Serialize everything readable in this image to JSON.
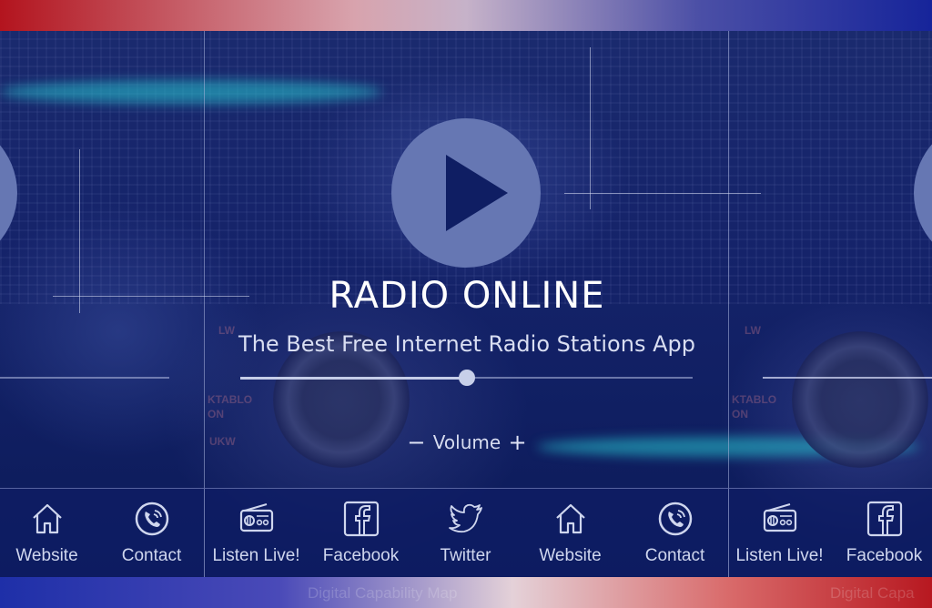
{
  "header": {
    "title": "RADIO ONLINE",
    "subtitle": "The Best Free Internet Radio Stations App"
  },
  "player": {
    "play_icon": "play-icon",
    "volume_label": "Volume",
    "volume_minus": "−",
    "volume_plus": "+",
    "volume_level": 0.5
  },
  "background": {
    "dial_labels": [
      "LW",
      "KTABLO",
      "ON",
      "UKW"
    ]
  },
  "nav": {
    "items": [
      {
        "label": "Website",
        "icon": "home-icon"
      },
      {
        "label": "Contact",
        "icon": "phone-icon"
      },
      {
        "label": "Listen Live!",
        "icon": "radio-icon"
      },
      {
        "label": "Facebook",
        "icon": "facebook-icon"
      },
      {
        "label": "Twitter",
        "icon": "twitter-icon"
      },
      {
        "label": "Website",
        "icon": "home-icon"
      },
      {
        "label": "Contact",
        "icon": "phone-icon"
      },
      {
        "label": "Listen Live!",
        "icon": "radio-icon"
      },
      {
        "label": "Facebook",
        "icon": "facebook-icon"
      }
    ]
  },
  "footer_ghost": {
    "left": "Digital Capability Map",
    "right": "Digital Capa"
  },
  "colors": {
    "accent": "#6677b3",
    "background": "#15236a",
    "text": "#ffffff"
  }
}
